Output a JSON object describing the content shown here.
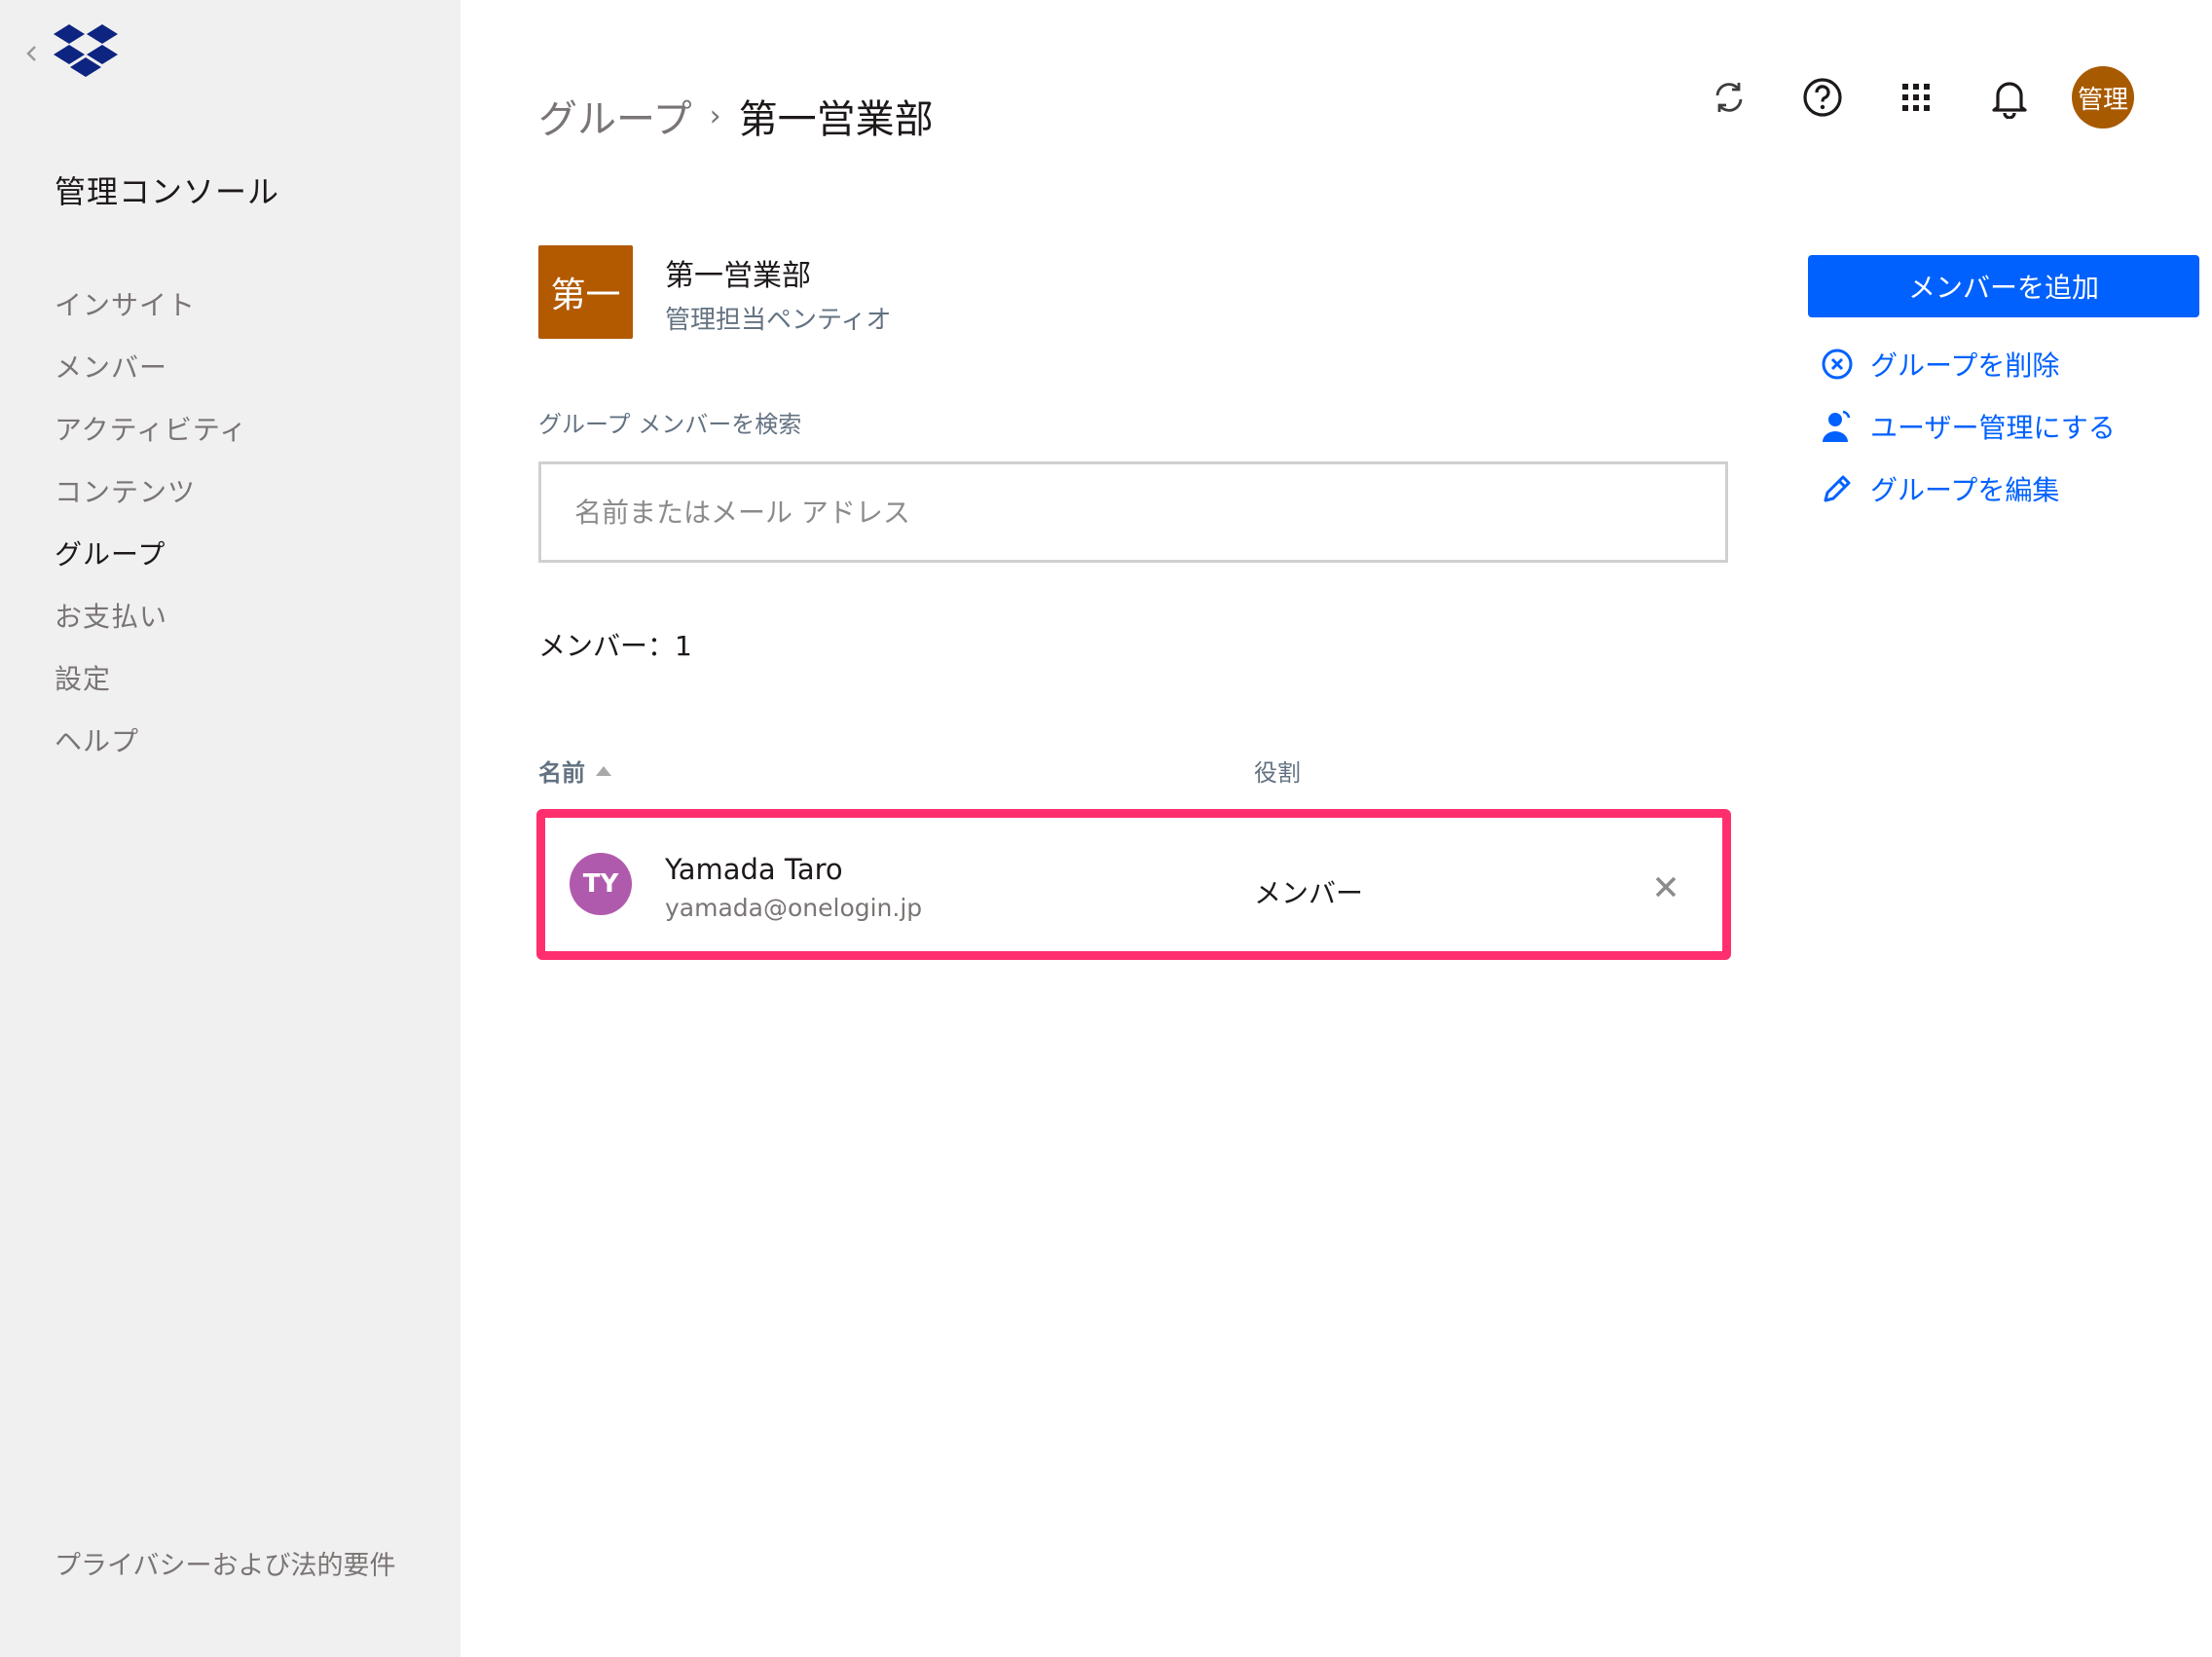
{
  "sidebar": {
    "console_title": "管理コンソール",
    "items": [
      {
        "label": "インサイト",
        "active": false
      },
      {
        "label": "メンバー",
        "active": false
      },
      {
        "label": "アクティビティ",
        "active": false
      },
      {
        "label": "コンテンツ",
        "active": false
      },
      {
        "label": "グループ",
        "active": true
      },
      {
        "label": "お支払い",
        "active": false
      },
      {
        "label": "設定",
        "active": false
      },
      {
        "label": "ヘルプ",
        "active": false
      }
    ],
    "privacy_link": "プライバシーおよび法的要件"
  },
  "header": {
    "breadcrumb_parent": "グループ",
    "breadcrumb_current": "第一営業部",
    "icons": [
      "sync-icon",
      "help-icon",
      "app-grid-icon",
      "bell-icon"
    ],
    "account_avatar": "管理"
  },
  "group": {
    "badge": "第一",
    "badge_color": "#b35900",
    "name": "第一営業部",
    "manager": "管理担当ペンティオ"
  },
  "search": {
    "label": "グループ メンバーを検索",
    "placeholder": "名前またはメール アドレス",
    "value": ""
  },
  "member_count": "メンバー：1",
  "table": {
    "col_name": "名前",
    "col_role": "役割",
    "rows": [
      {
        "initials": "TY",
        "avatar_color": "#b05aad",
        "name": "Yamada Taro",
        "email": "yamada@onelogin.jp",
        "role": "メンバー"
      }
    ]
  },
  "actions": {
    "add_member": "メンバーを追加",
    "delete_group": "グループを削除",
    "make_user_managed": "ユーザー管理にする",
    "edit_group": "グループを編集"
  },
  "colors": {
    "accent": "#0061fe",
    "highlight": "#ff2f6e",
    "sidebar_bg": "#f0f0f0",
    "logo": "#0d2481"
  }
}
